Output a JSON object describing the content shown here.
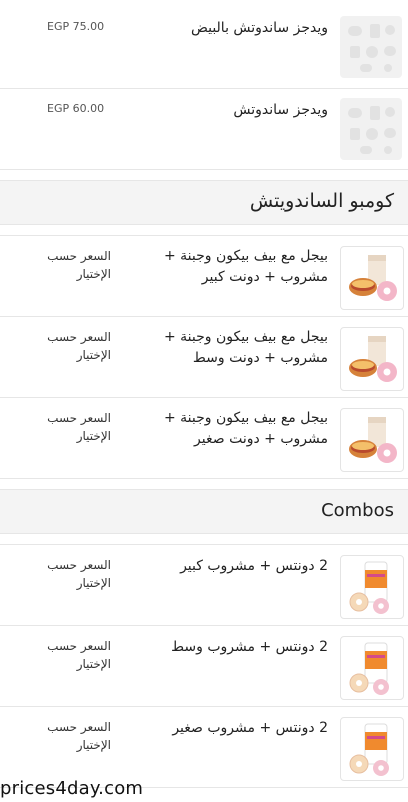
{
  "top_items": [
    {
      "name": "ويدجز ساندوتش بالبيض",
      "price": "EGP 75.00",
      "icon": "food-placeholder-icon"
    },
    {
      "name": "ويدجز ساندوتش",
      "price": "EGP 60.00",
      "icon": "food-placeholder-icon"
    }
  ],
  "section_1": {
    "title": "كومبو الساندويتش",
    "items": [
      {
        "name": "بيجل مع بيف بيكون وجبنة + مشروب + دونت كبير",
        "price": "السعر حسب الإختيار",
        "icon": "bagel-coffee-donut-icon"
      },
      {
        "name": "بيجل مع بيف بيكون وجبنة + مشروب + دونت وسط",
        "price": "السعر حسب الإختيار",
        "icon": "bagel-coffee-donut-icon"
      },
      {
        "name": "بيجل مع بيف بيكون وجبنة + مشروب + دونت صغير",
        "price": "السعر حسب الإختيار",
        "icon": "bagel-coffee-donut-icon"
      }
    ]
  },
  "section_2": {
    "title": "Combos",
    "items": [
      {
        "name": "2 دونتس + مشروب كبير",
        "price": "السعر حسب الإختيار",
        "icon": "donuts-cup-icon"
      },
      {
        "name": "2 دونتس + مشروب وسط",
        "price": "السعر حسب الإختيار",
        "icon": "donuts-cup-icon"
      },
      {
        "name": "2 دونتس + مشروب صغير",
        "price": "السعر حسب الإختيار",
        "icon": "donuts-cup-icon"
      }
    ]
  },
  "watermark": "prices4day.com"
}
